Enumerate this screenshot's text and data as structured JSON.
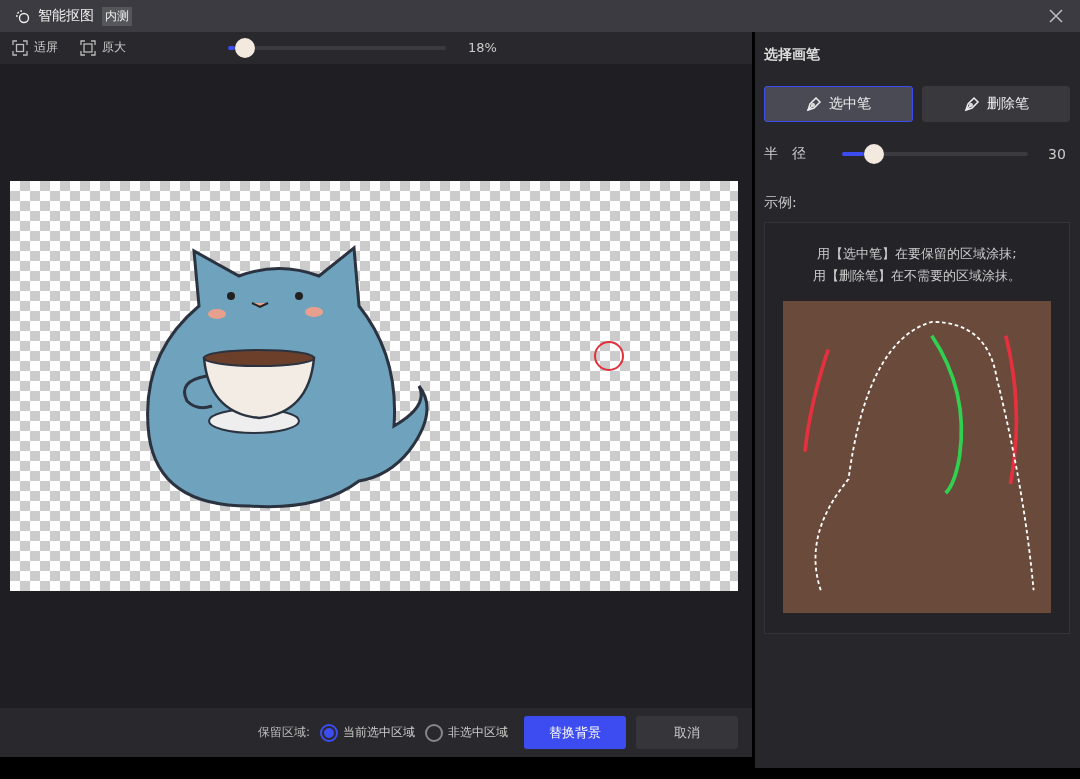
{
  "window": {
    "title": "智能抠图",
    "badge": "内测"
  },
  "toolbar": {
    "buttons": [
      {
        "kind": "fit",
        "label": "适屏"
      },
      {
        "kind": "actual",
        "label": "原大"
      }
    ],
    "zoom": {
      "level": 0.08,
      "reading": "18%"
    }
  },
  "panel": {
    "title": "选择画笔",
    "brushes": [
      {
        "label": "选中笔",
        "selected": true
      },
      {
        "label": "删除笔",
        "selected": false
      }
    ],
    "radius": {
      "label": "半　径",
      "level": 0.17,
      "reading": "30"
    },
    "example": {
      "title": "示例:",
      "lines": [
        "用【选中笔】在要保留的区域涂抹;",
        "用【删除笔】在不需要的区域涂抹。"
      ]
    }
  },
  "footer": {
    "label": "保留区域:",
    "options": [
      {
        "label": "当前选中区域",
        "selected": true
      },
      {
        "label": "非选中区域",
        "selected": false
      }
    ],
    "buttons": [
      {
        "kind": "primary",
        "label": "替换背景"
      },
      {
        "kind": "secondary",
        "label": "取消"
      }
    ]
  }
}
